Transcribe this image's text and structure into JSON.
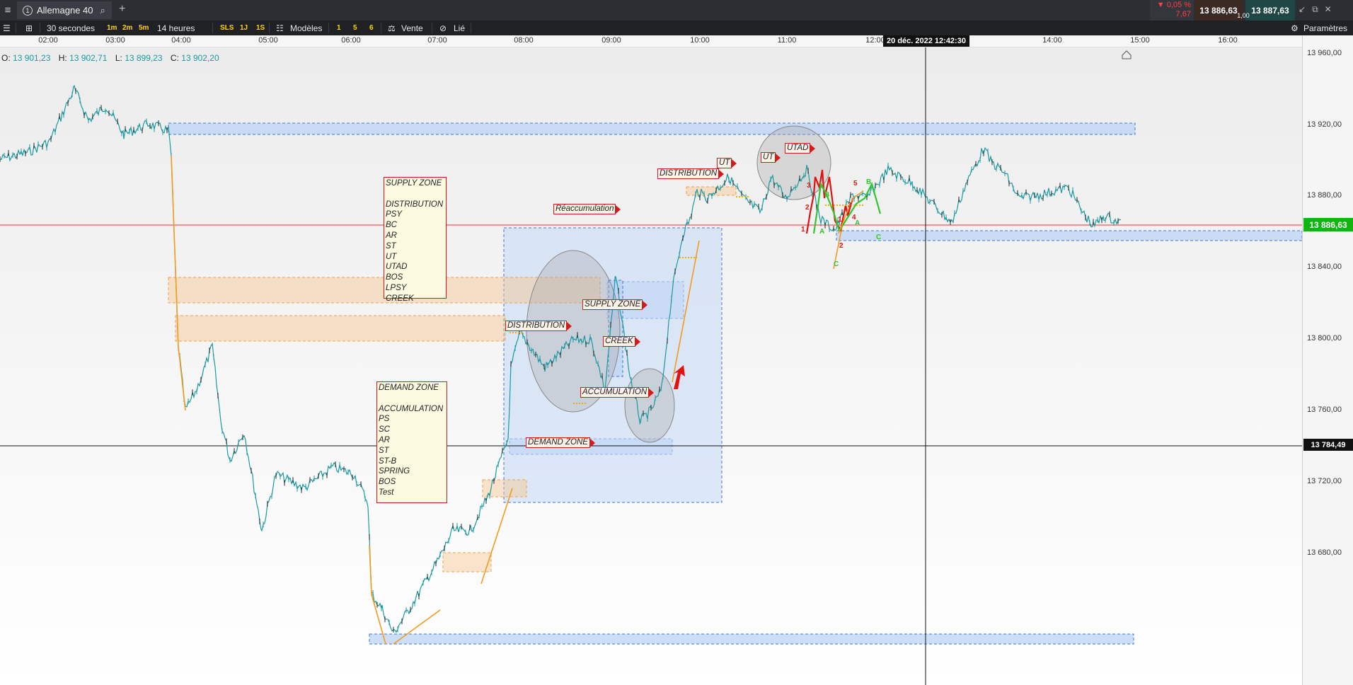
{
  "topbar": {
    "menu_icon": "hamburger-icon",
    "tab_number": "1",
    "tab_title": "Allemagne 40",
    "change_pct": "▼ 0,05 %",
    "change_abs": "7,67",
    "bid": "13 886,63",
    "spread": "1,00",
    "ask": "13 887,63"
  },
  "toolbar": {
    "interval": "30 secondes",
    "quick_1": "1m",
    "quick_2": "2m",
    "quick_3": "5m",
    "range": "14 heures",
    "sls": "SLS",
    "btn_1j": "1J",
    "btn_1s": "1S",
    "models": "Modèles",
    "n1": "1",
    "n5": "5",
    "n6": "6",
    "sell": "Vente",
    "linked": "Lié",
    "settings": "Paramètres"
  },
  "time_axis": {
    "labels": [
      "02:00",
      "03:00",
      "04:00",
      "05:00",
      "06:00",
      "07:00",
      "08:00",
      "09:00",
      "10:00",
      "11:00",
      "12:00",
      "14:00",
      "15:00",
      "16:00"
    ],
    "crosshair": "20 déc. 2022 12:42:30"
  },
  "ohlc": {
    "o_label": "O:",
    "o": "13 901,23",
    "h_label": "H:",
    "h": "13 902,71",
    "l_label": "L:",
    "l": "13 899,23",
    "c_label": "C:",
    "c": "13 902,20"
  },
  "price_scale": {
    "labels": [
      "13 960,00",
      "13 920,00",
      "13 880,00",
      "13 840,00",
      "13 800,00",
      "13 760,00",
      "13 720,00",
      "13 680,00"
    ],
    "last_price": "13 886,63",
    "crosshair_price": "13 784,49"
  },
  "annotations": {
    "supply_box": [
      "SUPPLY ZONE",
      "",
      "DISTRIBUTION",
      "PSY",
      "BC",
      "AR",
      "ST",
      "UT",
      "UTAD",
      "BOS",
      "LPSY",
      "CREEK"
    ],
    "demand_box": [
      "DEMAND ZONE",
      "",
      "ACCUMULATION",
      "PS",
      "SC",
      "AR",
      "ST",
      "ST-B",
      "SPRING",
      "BOS",
      "Test"
    ],
    "reaccumulation": "Réaccumulation",
    "distribution_1": "DISTRIBUTION",
    "supply_zone": "SUPPLY ZONE",
    "creek": "CREEK",
    "accumulation": "ACCUMULATION",
    "demand_zone": "DEMAND ZONE",
    "distribution_2": "DISTRIBUTION",
    "ut_1": "UT",
    "ut_2": "UT",
    "utad": "UTAD",
    "wave_labels": [
      "1",
      "2",
      "3",
      "1",
      "2",
      "3",
      "4",
      "5",
      "A",
      "B",
      "C",
      "A",
      "B",
      "C"
    ]
  },
  "colors": {
    "topbar_bg": "#2b2e33",
    "toolbar_bg": "#1f2125",
    "candle_up": "#1a9aa0",
    "candle_down": "#222222",
    "fast_move": "#f29b1c",
    "zone_blue": "#3c78d8",
    "zone_orange": "#f6c68e",
    "last_price_bg": "#10b510",
    "annotation_red": "#d31b1b"
  }
}
